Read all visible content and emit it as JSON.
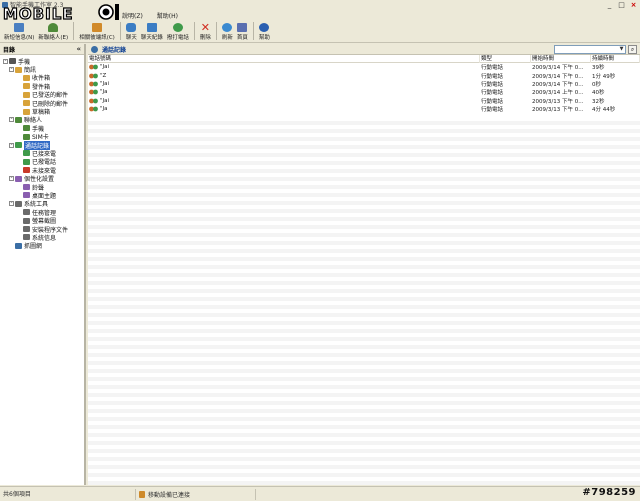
{
  "window": {
    "title": "智能手機工作室 2.3",
    "controls": [
      "minimize",
      "maximize",
      "close"
    ]
  },
  "logo": {
    "text": "MOBILE01"
  },
  "menubar": {
    "items": [
      "說明(Z)",
      "幫助(H)"
    ]
  },
  "toolbar": {
    "buttons": [
      {
        "label": "新短信息(N)",
        "icon": "new-sms-icon",
        "color": "#4a7fc1"
      },
      {
        "label": "新聯絡人(E)",
        "icon": "new-contact-icon",
        "color": "#4f8a3a"
      },
      {
        "label": "相關彼端訊(C)",
        "icon": "contacts-icon",
        "color": "#d18a2a"
      },
      {
        "label": "聊天",
        "icon": "chat-icon",
        "color": "#3b7dc4"
      },
      {
        "label": "聊天紀錄",
        "icon": "chat-log-icon",
        "color": "#3b7dc4"
      },
      {
        "label": "撥打電話",
        "icon": "dial-icon",
        "color": "#3f9a4a"
      },
      {
        "label": "刪除",
        "icon": "delete-icon",
        "color": "#d02a1e"
      },
      {
        "label": "刷新",
        "icon": "refresh-icon",
        "color": "#3a8ad0"
      },
      {
        "label": "首頁",
        "icon": "home-icon",
        "color": "#5a6fb0"
      },
      {
        "label": "幫助",
        "icon": "help-icon",
        "color": "#2a5fb0"
      }
    ]
  },
  "leftpane": {
    "title": "目錄",
    "collapse_glyph": "«",
    "tree": [
      {
        "label": "手機",
        "level": 0,
        "expander": "-",
        "icon_color": "#555555"
      },
      {
        "label": "簡訊",
        "level": 1,
        "expander": "-",
        "icon_color": "#d8a33a"
      },
      {
        "label": "收件箱",
        "level": 2,
        "expander": "",
        "icon_color": "#d8a33a"
      },
      {
        "label": "發件箱",
        "level": 2,
        "expander": "",
        "icon_color": "#d8a33a"
      },
      {
        "label": "已發送的郵件",
        "level": 2,
        "expander": "",
        "icon_color": "#d8a33a"
      },
      {
        "label": "已刪除的郵件",
        "level": 2,
        "expander": "",
        "icon_color": "#d8a33a"
      },
      {
        "label": "草稿箱",
        "level": 2,
        "expander": "",
        "icon_color": "#d8a33a"
      },
      {
        "label": "聯絡人",
        "level": 1,
        "expander": "-",
        "icon_color": "#4f8a3a"
      },
      {
        "label": "手機",
        "level": 2,
        "expander": "",
        "icon_color": "#4f8a3a"
      },
      {
        "label": "SIM卡",
        "level": 2,
        "expander": "",
        "icon_color": "#4f8a3a"
      },
      {
        "label": "通話記錄",
        "level": 1,
        "expander": "-",
        "icon_color": "#3f9a4a",
        "selected": true
      },
      {
        "label": "已接來電",
        "level": 2,
        "expander": "",
        "icon_color": "#3f9a4a"
      },
      {
        "label": "已撥電話",
        "level": 2,
        "expander": "",
        "icon_color": "#3f9a4a"
      },
      {
        "label": "未接來電",
        "level": 2,
        "expander": "",
        "icon_color": "#c93a2a"
      },
      {
        "label": "個性化設置",
        "level": 1,
        "expander": "-",
        "icon_color": "#8a5fb0"
      },
      {
        "label": "鈴聲",
        "level": 2,
        "expander": "",
        "icon_color": "#8a5fb0"
      },
      {
        "label": "桌面主題",
        "level": 2,
        "expander": "",
        "icon_color": "#8a5fb0"
      },
      {
        "label": "系統工具",
        "level": 1,
        "expander": "-",
        "icon_color": "#6a6a6a"
      },
      {
        "label": "任務管理",
        "level": 2,
        "expander": "",
        "icon_color": "#6a6a6a"
      },
      {
        "label": "螢幕截圖",
        "level": 2,
        "expander": "",
        "icon_color": "#6a6a6a"
      },
      {
        "label": "安裝程序文件",
        "level": 2,
        "expander": "",
        "icon_color": "#6a6a6a"
      },
      {
        "label": "系統信息",
        "level": 2,
        "expander": "",
        "icon_color": "#6a6a6a"
      },
      {
        "label": "抓圖網",
        "level": 1,
        "expander": "",
        "icon_color": "#3a6ea5"
      }
    ]
  },
  "rightpane": {
    "title": "通話記錄",
    "filter": {
      "value": "",
      "dropdown_glyph": "▼",
      "button_glyph": "⌕"
    },
    "columns": [
      "電話號碼",
      "類型",
      "開始時間",
      "持續時間"
    ],
    "rows": [
      {
        "number": "\"Jai",
        "type": "行動電話",
        "start": "2009/3/14  下午 0...",
        "duration": "39秒"
      },
      {
        "number": "\"Z",
        "type": "行動電話",
        "start": "2009/3/14  下午 0...",
        "duration": "1分 49秒"
      },
      {
        "number": "\"Jai",
        "type": "行動電話",
        "start": "2009/3/14  下午 0...",
        "duration": "0秒"
      },
      {
        "number": "\"Ja",
        "type": "行動電話",
        "start": "2009/3/14  上午 0...",
        "duration": "40秒"
      },
      {
        "number": "\"Jai",
        "type": "行動電話",
        "start": "2009/3/13  下午 0...",
        "duration": "32秒"
      },
      {
        "number": "\"Ja",
        "type": "行動電話",
        "start": "2009/3/13  下午 0...",
        "duration": "4分 44秒"
      }
    ]
  },
  "statusbar": {
    "left": "共6個項目",
    "device": "移動設備已連接"
  },
  "watermark": "#798259"
}
